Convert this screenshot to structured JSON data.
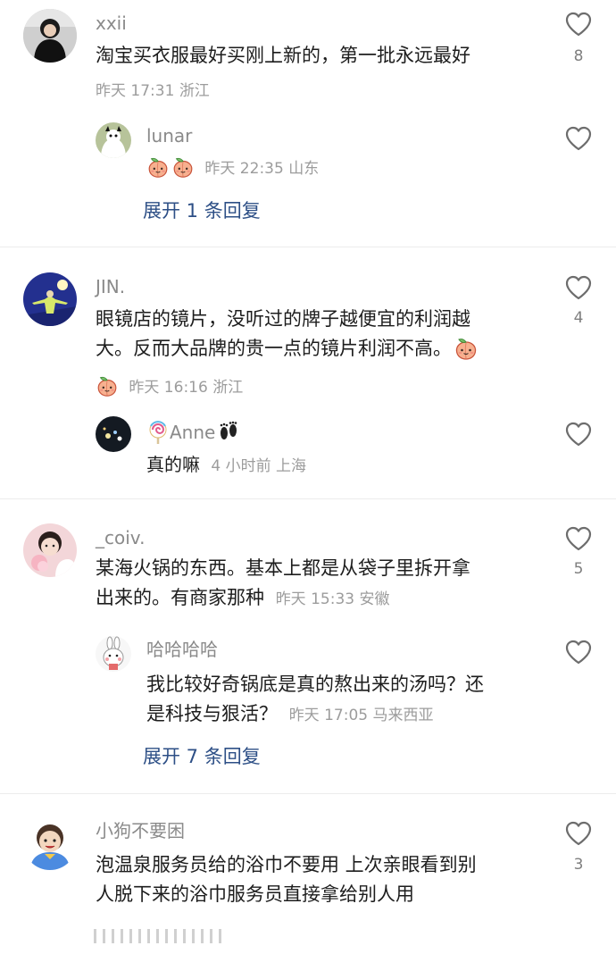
{
  "comments": [
    {
      "user": "xxii",
      "text_lines": [
        "淘宝买衣服最好买刚上新的，第一批永远最好"
      ],
      "time": "昨天 17:31",
      "location": "浙江",
      "likes": "8",
      "reply": {
        "user": "lunar",
        "time": "昨天 22:35",
        "location": "山东"
      },
      "expand_label": "展开 1 条回复"
    },
    {
      "user": "JIN.",
      "text_lines": [
        "眼镜店的镜片，没听过的牌子越便宜的利润越",
        "大。反而大品牌的贵一点的镜片利润不高。"
      ],
      "time": "昨天 16:16",
      "location": "浙江",
      "likes": "4",
      "reply": {
        "user": "Anne",
        "text": "真的嘛",
        "time": "4 小时前",
        "location": "上海"
      }
    },
    {
      "user": "_coiv.",
      "text_lines": [
        "某海火锅的东西。基本上都是从袋子里拆开拿",
        "出来的。有商家那种"
      ],
      "time": "昨天 15:33",
      "location": "安徽",
      "likes": "5",
      "reply": {
        "user": "哈哈哈哈",
        "text_lines": [
          "我比较好奇锅底是真的熬出来的汤吗？还",
          "是科技与狠活？"
        ],
        "time": "昨天 17:05",
        "location": "马来西亚"
      },
      "expand_label": "展开 7 条回复"
    },
    {
      "user": "小狗不要困",
      "text_lines": [
        "泡温泉服务员给的浴巾不要用 上次亲眼看到别",
        "人脱下来的浴巾服务员直接拿给别人用"
      ],
      "likes": "3"
    }
  ],
  "colors": {
    "username": "#8a8a8a",
    "text": "#1d1d1d",
    "meta": "#9c9c9c",
    "expand": "#2d4f86",
    "divider": "#ececec"
  },
  "icons": {
    "like": "heart-outline-icon",
    "emoji": "peach-emoji-icon",
    "lollipop": "lollipop-emoji-icon",
    "footprints": "footprints-emoji-icon"
  }
}
